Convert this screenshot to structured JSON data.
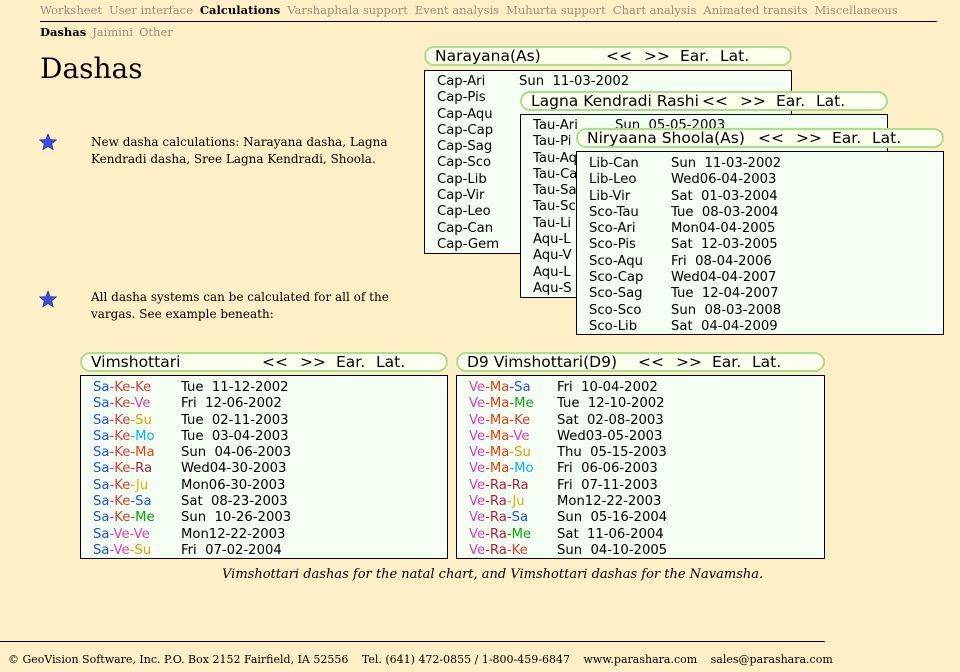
{
  "nav": {
    "items": [
      "Worksheet",
      "User interface",
      "Calculations",
      "Varshaphala support",
      "Event analysis",
      "Muhurta support",
      "Chart analysis",
      "Animated transits",
      "Miscellaneous"
    ],
    "current": "Calculations"
  },
  "subnav": {
    "items": [
      "Dashas",
      "Jaimini",
      "Other"
    ],
    "current": "Dashas"
  },
  "page_title": "Dashas",
  "bullets": [
    "New dasha calculations: Narayana dasha, Lagna Kendradi dasha, Sree Lagna Kendradi, Shoola.",
    "All dasha systems can be calculated for all of the vargas. See example beneath:"
  ],
  "controls": {
    "prev": "<<",
    "next": ">>",
    "ear": "Ear.",
    "lat": "Lat."
  },
  "narayana": {
    "title": "Narayana(As)",
    "rows": [
      {
        "a": "Cap-Ari",
        "d": "Sun  11-03-2002"
      },
      {
        "a": "Cap-Pis",
        "d": ""
      },
      {
        "a": "Cap-Aqu",
        "d": ""
      },
      {
        "a": "Cap-Cap",
        "d": ""
      },
      {
        "a": "Cap-Sag",
        "d": ""
      },
      {
        "a": "Cap-Sco",
        "d": ""
      },
      {
        "a": "Cap-Lib",
        "d": ""
      },
      {
        "a": "Cap-Vir",
        "d": ""
      },
      {
        "a": "Cap-Leo",
        "d": ""
      },
      {
        "a": "Cap-Can",
        "d": ""
      },
      {
        "a": "Cap-Gem",
        "d": ""
      }
    ]
  },
  "lagna": {
    "title": "Lagna Kendradi Rashi",
    "rows": [
      {
        "a": "Tau-Ari",
        "d": "Sun  05-05-2003"
      },
      {
        "a": "Tau-Pi",
        "d": ""
      },
      {
        "a": "Tau-Aq",
        "d": ""
      },
      {
        "a": "Tau-Ca",
        "d": ""
      },
      {
        "a": "Tau-Sa",
        "d": ""
      },
      {
        "a": "Tau-Sc",
        "d": ""
      },
      {
        "a": "Tau-Li",
        "d": ""
      },
      {
        "a": "Aqu-L",
        "d": ""
      },
      {
        "a": "Aqu-V",
        "d": ""
      },
      {
        "a": "Aqu-L",
        "d": ""
      },
      {
        "a": "Aqu-S",
        "d": ""
      }
    ]
  },
  "shoola": {
    "title": "Niryaana Shoola(As)",
    "rows": [
      {
        "a": "Lib-Can",
        "d": "Sun  11-03-2002"
      },
      {
        "a": "Lib-Leo",
        "d": "Wed06-04-2003"
      },
      {
        "a": "Lib-Vir",
        "d": "Sat  01-03-2004"
      },
      {
        "a": "Sco-Tau",
        "d": "Tue  08-03-2004"
      },
      {
        "a": "Sco-Ari",
        "d": "Mon04-04-2005"
      },
      {
        "a": "Sco-Pis",
        "d": "Sat  12-03-2005"
      },
      {
        "a": "Sco-Aqu",
        "d": "Fri  08-04-2006"
      },
      {
        "a": "Sco-Cap",
        "d": "Wed04-04-2007"
      },
      {
        "a": "Sco-Sag",
        "d": "Tue  12-04-2007"
      },
      {
        "a": "Sco-Sco",
        "d": "Sun  08-03-2008"
      },
      {
        "a": "Sco-Lib",
        "d": "Sat  04-04-2009"
      }
    ]
  },
  "vimshottari": {
    "title": "Vimshottari",
    "rows": [
      {
        "p": [
          "Sa",
          "Ke",
          "Ke"
        ],
        "d": "Tue  11-12-2002"
      },
      {
        "p": [
          "Sa",
          "Ke",
          "Ve"
        ],
        "d": "Fri  12-06-2002"
      },
      {
        "p": [
          "Sa",
          "Ke",
          "Su"
        ],
        "d": "Tue  02-11-2003"
      },
      {
        "p": [
          "Sa",
          "Ke",
          "Mo"
        ],
        "d": "Tue  03-04-2003"
      },
      {
        "p": [
          "Sa",
          "Ke",
          "Ma"
        ],
        "d": "Sun  04-06-2003"
      },
      {
        "p": [
          "Sa",
          "Ke",
          "Ra"
        ],
        "d": "Wed04-30-2003"
      },
      {
        "p": [
          "Sa",
          "Ke",
          "Ju"
        ],
        "d": "Mon06-30-2003"
      },
      {
        "p": [
          "Sa",
          "Ke",
          "Sa"
        ],
        "d": "Sat  08-23-2003"
      },
      {
        "p": [
          "Sa",
          "Ke",
          "Me"
        ],
        "d": "Sun  10-26-2003"
      },
      {
        "p": [
          "Sa",
          "Ve",
          "Ve"
        ],
        "d": "Mon12-22-2003"
      },
      {
        "p": [
          "Sa",
          "Ve",
          "Su"
        ],
        "d": "Fri  07-02-2004"
      }
    ]
  },
  "d9": {
    "title": "D9  Vimshottari(D9)",
    "rows": [
      {
        "p": [
          "Ve",
          "Ma",
          "Sa"
        ],
        "d": "Fri  10-04-2002"
      },
      {
        "p": [
          "Ve",
          "Ma",
          "Me"
        ],
        "d": "Tue  12-10-2002"
      },
      {
        "p": [
          "Ve",
          "Ma",
          "Ke"
        ],
        "d": "Sat  02-08-2003"
      },
      {
        "p": [
          "Ve",
          "Ma",
          "Ve"
        ],
        "d": "Wed03-05-2003"
      },
      {
        "p": [
          "Ve",
          "Ma",
          "Su"
        ],
        "d": "Thu  05-15-2003"
      },
      {
        "p": [
          "Ve",
          "Ma",
          "Mo"
        ],
        "d": "Fri  06-06-2003"
      },
      {
        "p": [
          "Ve",
          "Ra",
          "Ra"
        ],
        "d": "Fri  07-11-2003"
      },
      {
        "p": [
          "Ve",
          "Ra",
          "Ju"
        ],
        "d": "Mon12-22-2003"
      },
      {
        "p": [
          "Ve",
          "Ra",
          "Sa"
        ],
        "d": "Sun  05-16-2004"
      },
      {
        "p": [
          "Ve",
          "Ra",
          "Me"
        ],
        "d": "Sat  11-06-2004"
      },
      {
        "p": [
          "Ve",
          "Ra",
          "Ke"
        ],
        "d": "Sun  04-10-2005"
      }
    ]
  },
  "caption": "Vimshottari dashas for the natal chart, and Vimshottari dashas for the Navamsha.",
  "footer": {
    "copyright": "© GeoVision Software, Inc. P.O. Box 2152 Fairfield, IA 52556",
    "tel": "Tel. (641) 472-0855 / 1-800-459-6847",
    "web": "www.parashara.com",
    "email": "sales@parashara.com"
  },
  "colors": {
    "background": "#ffefc6",
    "header_border": "#a6e18c",
    "panel_bg": "#f4fef2",
    "planets": {
      "Sa": "#1e50e6",
      "Ke": "#d23c3c",
      "Ve": "#e040b0",
      "Su": "#e69a00",
      "Mo": "#00b4f0",
      "Ma": "#e04010",
      "Ra": "#b02040",
      "Ju": "#e0b000",
      "Me": "#10a010"
    }
  }
}
